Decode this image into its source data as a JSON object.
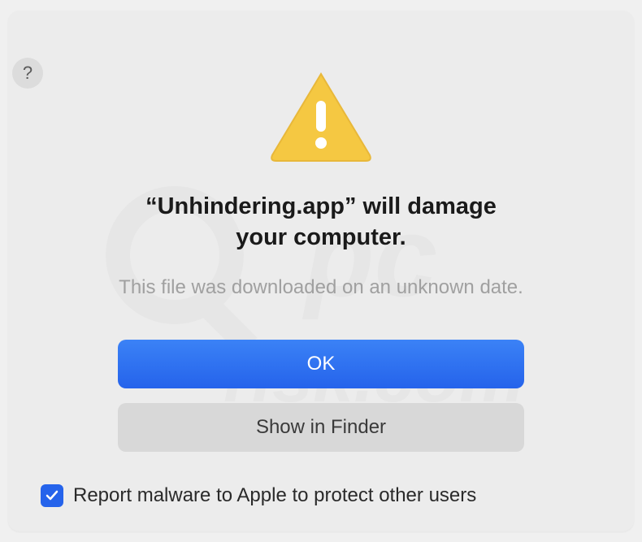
{
  "dialog": {
    "title_line1": "“Unhindering.app” will damage",
    "title_line2": "your computer.",
    "subtitle": "This file was downloaded on an unknown date.",
    "primary_button": "OK",
    "secondary_button": "Show in Finder",
    "checkbox_label": "Report malware to Apple to protect other users",
    "checkbox_checked": true,
    "help_label": "?"
  },
  "icons": {
    "warning": "warning-triangle",
    "help": "help-circle",
    "checkmark": "checkmark"
  },
  "colors": {
    "primary": "#2563eb",
    "background": "#ececec",
    "text_primary": "#1a1a1a",
    "text_secondary": "#a0a0a0"
  }
}
